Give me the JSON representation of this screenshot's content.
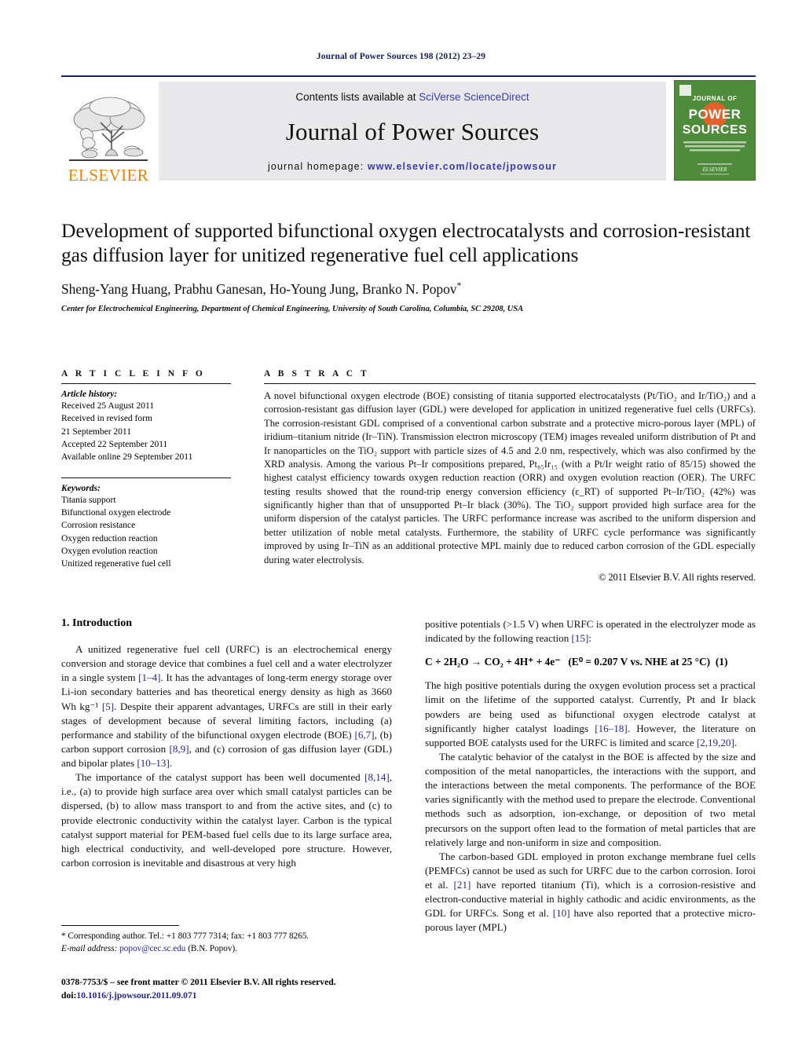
{
  "running_head": "Journal of Power Sources 198 (2012) 23–29",
  "masthead": {
    "elsevier_wordmark": "ELSEVIER",
    "contents_prefix": "Contents lists available at ",
    "contents_link": "SciVerse ScienceDirect",
    "journal_name": "Journal of Power Sources",
    "homepage_prefix": "journal homepage: ",
    "homepage_url": "www.elsevier.com/locate/jpowsour",
    "cover": {
      "line1": "JOURNAL OF",
      "line2": "POWER",
      "line3": "SOURCES",
      "blurb": "The International Journal on the Science and Technology of Batteries, Fuel Cells and other Electrochemical Systems",
      "publisher": "ELSEVIER",
      "bg_color": "#4e8b3a",
      "accent_color": "#e4622a"
    },
    "link_color": "#3a3ab4"
  },
  "article": {
    "title": "Development of supported bifunctional oxygen electrocatalysts and corrosion-resistant gas diffusion layer for unitized regenerative fuel cell applications",
    "authors": "Sheng-Yang Huang, Prabhu Ganesan, Ho-Young Jung, Branko N. Popov",
    "corresponding_marker": "*",
    "affiliation": "Center for Electrochemical Engineering, Department of Chemical Engineering, University of South Carolina, Columbia, SC 29208, USA"
  },
  "article_info": {
    "heading": "A R T I C L E    I N F O",
    "history_heading": "Article history:",
    "history": [
      "Received 25 August 2011",
      "Received in revised form",
      "21 September 2011",
      "Accepted 22 September 2011",
      "Available online 29 September 2011"
    ],
    "keywords_heading": "Keywords:",
    "keywords": [
      "Titania support",
      "Bifunctional oxygen electrode",
      "Corrosion resistance",
      "Oxygen reduction reaction",
      "Oxygen evolution reaction",
      "Unitized regenerative fuel cell"
    ]
  },
  "abstract": {
    "heading": "A B S T R A C T",
    "paragraphs": [
      "A novel bifunctional oxygen electrode (BOE) consisting of titania supported electrocatalysts (Pt/TiO₂ and Ir/TiO₂) and a corrosion-resistant gas diffusion layer (GDL) were developed for application in unitized regenerative fuel cells (URFCs). The corrosion-resistant GDL comprised of a conventional carbon substrate and a protective micro-porous layer (MPL) of iridium–titanium nitride (Ir–TiN). Transmission electron microscopy (TEM) images revealed uniform distribution of Pt and Ir nanoparticles on the TiO₂ support with particle sizes of 4.5 and 2.0 nm, respectively, which was also confirmed by the XRD analysis. Among the various Pt–Ir compositions prepared, Pt₈₅Ir₁₅ (with a Pt/Ir weight ratio of 85/15) showed the highest catalyst efficiency towards oxygen reduction reaction (ORR) and oxygen evolution reaction (OER). The URFC testing results showed that the round-trip energy conversion efficiency (ε_RT) of supported Pt–Ir/TiO₂ (42%) was significantly higher than that of unsupported Pt–Ir black (30%). The TiO₂ support provided high surface area for the uniform dispersion of the catalyst particles. The URFC performance increase was ascribed to the uniform dispersion and better utilization of noble metal catalysts. Furthermore, the stability of URFC cycle performance was significantly improved by using Ir–TiN as an additional protective MPL mainly due to reduced carbon corrosion of the GDL especially during water electrolysis."
    ],
    "copyright": "© 2011 Elsevier B.V. All rights reserved."
  },
  "body": {
    "section_number_title": "1.  Introduction",
    "left_paragraphs": [
      "A unitized regenerative fuel cell (URFC) is an electrochemical energy conversion and storage device that combines a fuel cell and a water electrolyzer in a single system [1–4]. It has the advantages of long-term energy storage over Li-ion secondary batteries and has theoretical energy density as high as 3660 Wh kg⁻¹ [5]. Despite their apparent advantages, URFCs are still in their early stages of development because of several limiting factors, including (a) performance and stability of the bifunctional oxygen electrode (BOE) [6,7], (b) carbon support corrosion [8,9], and (c) corrosion of gas diffusion layer (GDL) and bipolar plates [10–13].",
      "The importance of the catalyst support has been well documented [8,14], i.e., (a) to provide high surface area over which small catalyst particles can be dispersed, (b) to allow mass transport to and from the active sites, and (c) to provide electronic conductivity within the catalyst layer. Carbon is the typical catalyst support material for PEM-based fuel cells due to its large surface area, high electrical conductivity, and well-developed pore structure. However, carbon corrosion is inevitable and disastrous at very high"
    ],
    "right_intro": "positive potentials (>1.5 V) when URFC is operated in the electrolyzer mode as indicated by the following reaction [15]:",
    "equation": {
      "text": "C + 2H₂O → CO₂ + 4H⁺ + 4e⁻",
      "condition": "(E⁰ = 0.207 V vs. NHE at 25 °C)",
      "number": "(1)"
    },
    "right_paragraphs": [
      "The high positive potentials during the oxygen evolution process set a practical limit on the lifetime of the supported catalyst. Currently, Pt and Ir black powders are being used as bifunctional oxygen electrode catalyst at significantly higher catalyst loadings [16–18]. However, the literature on supported BOE catalysts used for the URFC is limited and scarce [2,19,20].",
      "The catalytic behavior of the catalyst in the BOE is affected by the size and composition of the metal nanoparticles, the interactions with the support, and the interactions between the metal components. The performance of the BOE varies significantly with the method used to prepare the electrode. Conventional methods such as adsorption, ion-exchange, or deposition of two metal precursors on the support often lead to the formation of metal particles that are relatively large and non-uniform in size and composition.",
      "The carbon-based GDL employed in proton exchange membrane fuel cells (PEMFCs) cannot be used as such for URFC due to the carbon corrosion. Ioroi et al. [21] have reported titanium (Ti), which is a corrosion-resistive and electron-conductive material in highly cathodic and acidic environments, as the GDL for URFCs. Song et al. [10] have also reported that a protective micro-porous layer (MPL)"
    ]
  },
  "footnote": {
    "line1": "* Corresponding author. Tel.: +1 803 777 7314; fax: +1 803 777 8265.",
    "email_label": "E-mail address:",
    "email": "popov@cec.sc.edu",
    "email_suffix": "(B.N. Popov)."
  },
  "footer": {
    "issn_line": "0378-7753/$ – see front matter © 2011 Elsevier B.V. All rights reserved.",
    "doi_prefix": "doi:",
    "doi": "10.1016/j.jpowsour.2011.09.071"
  },
  "colors": {
    "link": "#24248f",
    "header_blue": "#1b2060",
    "elsevier_orange": "#f08000",
    "banner_gray": "#e8e8ea"
  }
}
